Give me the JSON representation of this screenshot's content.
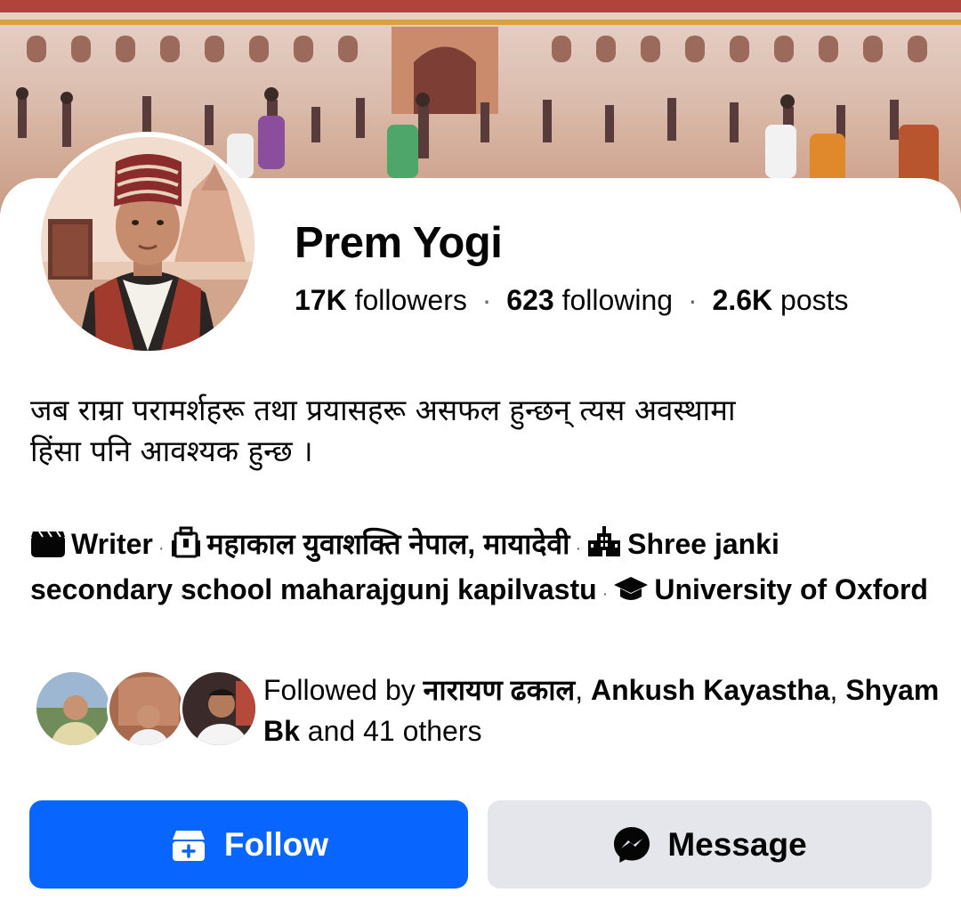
{
  "profile": {
    "name": "Prem Yogi",
    "stats": {
      "followers_count": "17K",
      "followers_label": "followers",
      "following_count": "623",
      "following_label": "following",
      "posts_count": "2.6K",
      "posts_label": "posts",
      "separator": "·"
    },
    "bio_line1": "जब राम्रा परामर्शहरू तथा प्रयासहरू असफल हुन्छन् त्यस अवस्थामा",
    "bio_line2": "हिंसा पनि आवश्यक हुन्छ ।",
    "details": {
      "occupation": "Writer",
      "workplace": "महाकाल युवाशक्ति नेपाल, मायादेवी",
      "school": "Shree janki secondary school maharajgunj kapilvastu",
      "university": "University of Oxford",
      "separator": "·"
    },
    "mutual": {
      "prefix": "Followed by",
      "friend1": "नारायण ढकाल",
      "friend2": "Ankush Kayastha",
      "friend3": "Shyam Bk",
      "suffix": "and 41 others"
    }
  },
  "actions": {
    "follow_label": "Follow",
    "message_label": "Message"
  },
  "icons": {
    "occupation": "clapperboard-icon",
    "workplace": "office-building-icon",
    "school": "school-building-icon",
    "university": "graduation-cap-icon",
    "follow": "follow-icon",
    "message": "messenger-icon"
  },
  "colors": {
    "primary": "#0866ff",
    "secondary_button": "#e4e6eb",
    "text": "#050505",
    "muted": "#65676b"
  }
}
